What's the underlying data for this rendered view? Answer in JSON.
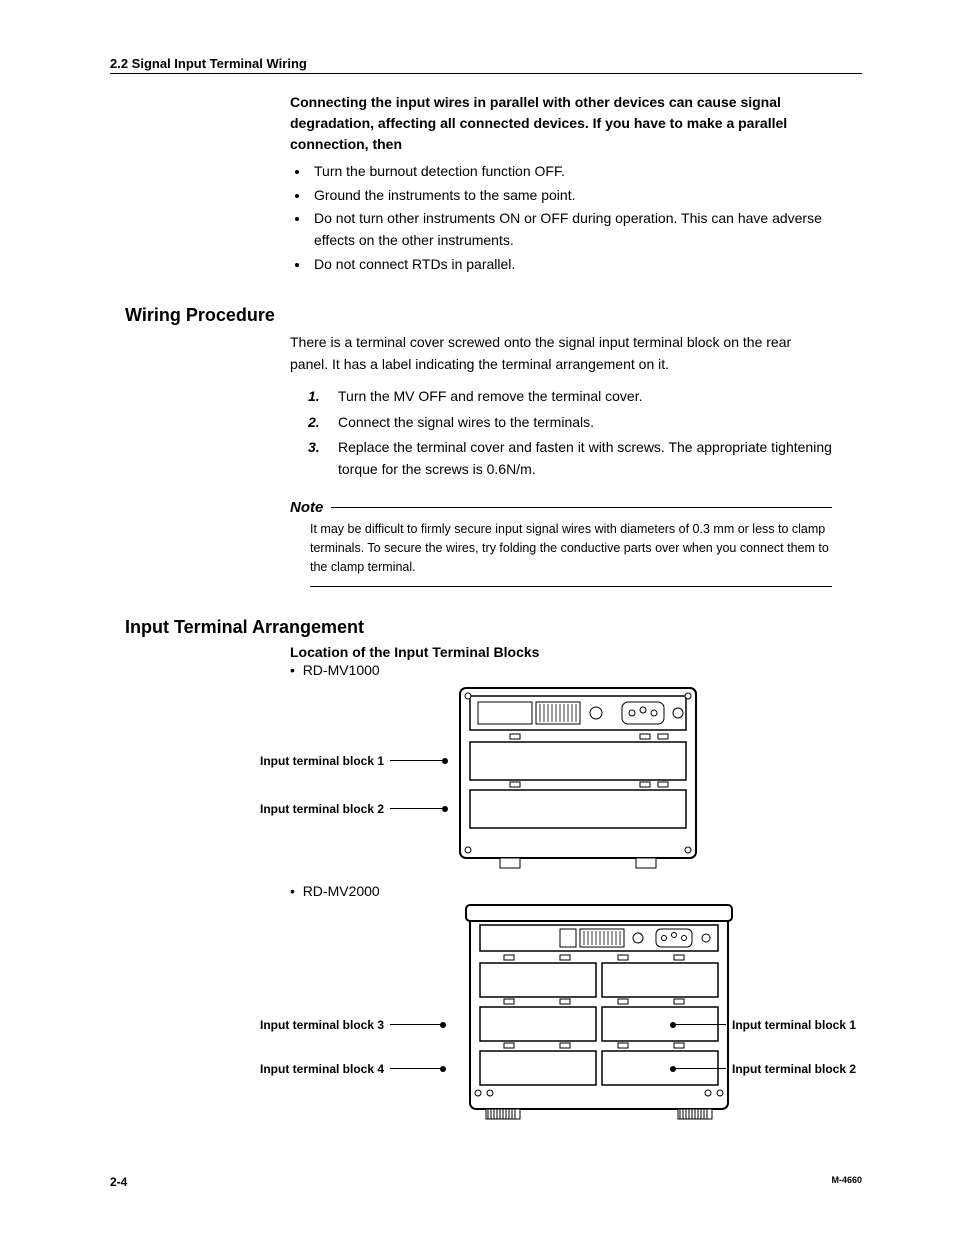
{
  "header": "2.2  Signal Input Terminal Wiring",
  "intro": "Connecting the input wires in parallel with other devices can cause signal degradation, affecting all connected devices. If you have to make a parallel connection, then",
  "intro_bullets": [
    "Turn the burnout detection function OFF.",
    "Ground the instruments to the same point.",
    "Do not turn other instruments ON or OFF during operation. This can have adverse effects on the other instruments.",
    "Do not connect RTDs in parallel."
  ],
  "wiring": {
    "heading": "Wiring Procedure",
    "para": "There is a terminal cover screwed onto the signal input terminal block on the rear panel. It has a label indicating the terminal arrangement on it.",
    "steps": [
      "Turn the MV OFF and remove the terminal cover.",
      "Connect the signal wires to the terminals.",
      "Replace the terminal cover and fasten it with screws. The appropriate tightening torque for the screws is 0.6N/m."
    ],
    "note_label": "Note",
    "note_body": "It may be difficult to firmly secure input signal wires with diameters of 0.3 mm or less to clamp terminals. To secure the wires, try folding the conductive parts over when you connect them to the clamp terminal."
  },
  "arrangement": {
    "heading": "Input Terminal Arrangement",
    "subheading": "Location of the Input Terminal Blocks",
    "models": [
      "RD-MV1000",
      "RD-MV2000"
    ],
    "labels": {
      "block1": "Input terminal block 1",
      "block2": "Input terminal block 2",
      "block3": "Input terminal block 3",
      "block4": "Input terminal block 4"
    }
  },
  "footer": {
    "page": "2-4",
    "docid": "M-4660"
  }
}
